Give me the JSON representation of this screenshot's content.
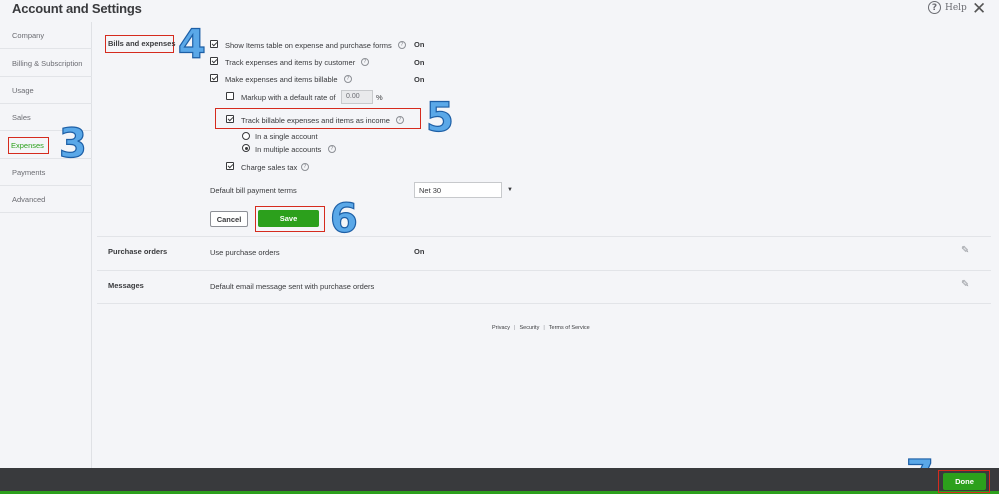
{
  "header": {
    "title": "Account and Settings",
    "help_label": "Help",
    "help_glyph": "?",
    "close_glyph": "✕"
  },
  "sidebar": {
    "items": [
      {
        "label": "Company"
      },
      {
        "label": "Billing & Subscription"
      },
      {
        "label": "Usage"
      },
      {
        "label": "Sales"
      },
      {
        "label": "Expenses",
        "active": true
      },
      {
        "label": "Payments"
      },
      {
        "label": "Advanced"
      }
    ]
  },
  "bills": {
    "section_label": "Bills and expenses",
    "show_items_table": {
      "label": "Show Items table on expense and purchase forms",
      "checked": true,
      "value": "On"
    },
    "track_by_customer": {
      "label": "Track expenses and items by customer",
      "checked": true,
      "value": "On"
    },
    "make_billable": {
      "label": "Make expenses and items billable",
      "checked": true,
      "value": "On"
    },
    "markup": {
      "label": "Markup with a default rate of",
      "checked": false,
      "rate": "0.00",
      "unit": "%"
    },
    "track_income": {
      "label": "Track billable expenses and items as income",
      "checked": true
    },
    "radio_single": {
      "label": "In a single account",
      "selected": false
    },
    "radio_multiple": {
      "label": "In multiple accounts",
      "selected": true
    },
    "sales_tax": {
      "label": "Charge sales tax",
      "checked": true
    },
    "payment_terms": {
      "label": "Default bill payment terms",
      "value": "Net 30"
    },
    "cancel_label": "Cancel",
    "save_label": "Save"
  },
  "purchase_orders": {
    "section_label": "Purchase orders",
    "setting": "Use purchase orders",
    "value": "On"
  },
  "messages": {
    "section_label": "Messages",
    "setting": "Default email message sent with purchase orders"
  },
  "footer": {
    "privacy": "Privacy",
    "security": "Security",
    "terms": "Terms of Service",
    "separator": "|"
  },
  "bottom": {
    "done_label": "Done"
  },
  "annotations": {
    "step3": "3",
    "step4": "4",
    "step5": "5",
    "step6": "6",
    "step7": "7"
  },
  "colors": {
    "accent_green": "#2ca01c",
    "highlight_red": "#d52b1e",
    "annotation_blue": "#5aa8e8",
    "bottom_bar": "#393a3d"
  }
}
